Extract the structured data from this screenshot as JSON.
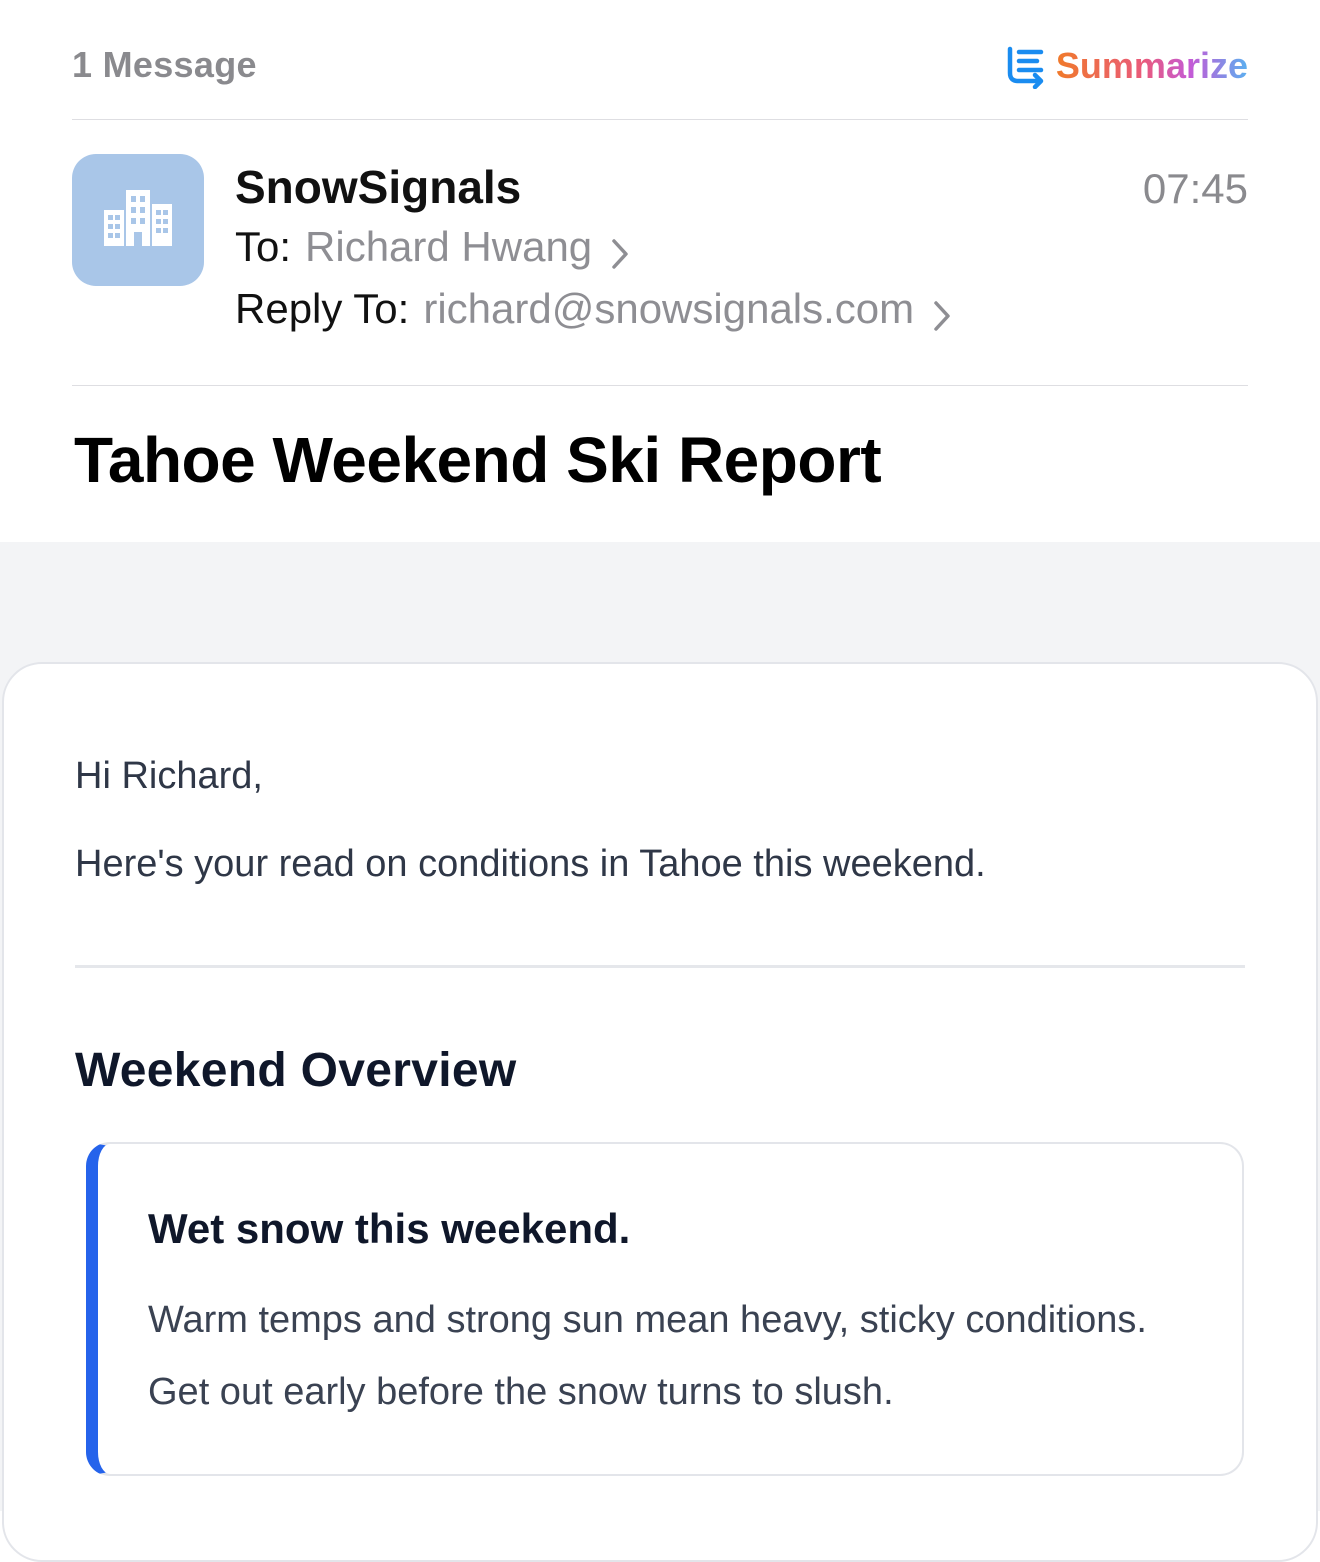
{
  "header": {
    "message_count": "1 Message",
    "summarize_label": "Summarize"
  },
  "sender": {
    "name": "SnowSignals",
    "time": "07:45",
    "to_label": "To:",
    "to_value": "Richard Hwang",
    "reply_to_label": "Reply To:",
    "reply_to_value": "richard@snowsignals.com",
    "avatar_icon": "building-icon",
    "avatar_color": "#a9c6e8"
  },
  "subject": "Tahoe Weekend Ski Report",
  "body": {
    "greeting": "Hi Richard,",
    "intro": "Here's your read on conditions in Tahoe this weekend.",
    "section_heading": "Weekend Overview",
    "callout": {
      "title": "Wet snow this weekend.",
      "text": "Warm temps and strong sun mean heavy, sticky conditions. Get out early before the snow turns to slush.",
      "accent_color": "#2563eb"
    }
  },
  "colors": {
    "summarize_gradient": [
      "#f07a2a",
      "#ea5a7a",
      "#c45ad6",
      "#5ab0f0"
    ],
    "summarize_icon": "#1a8cf0",
    "body_background": "#f3f4f6"
  }
}
